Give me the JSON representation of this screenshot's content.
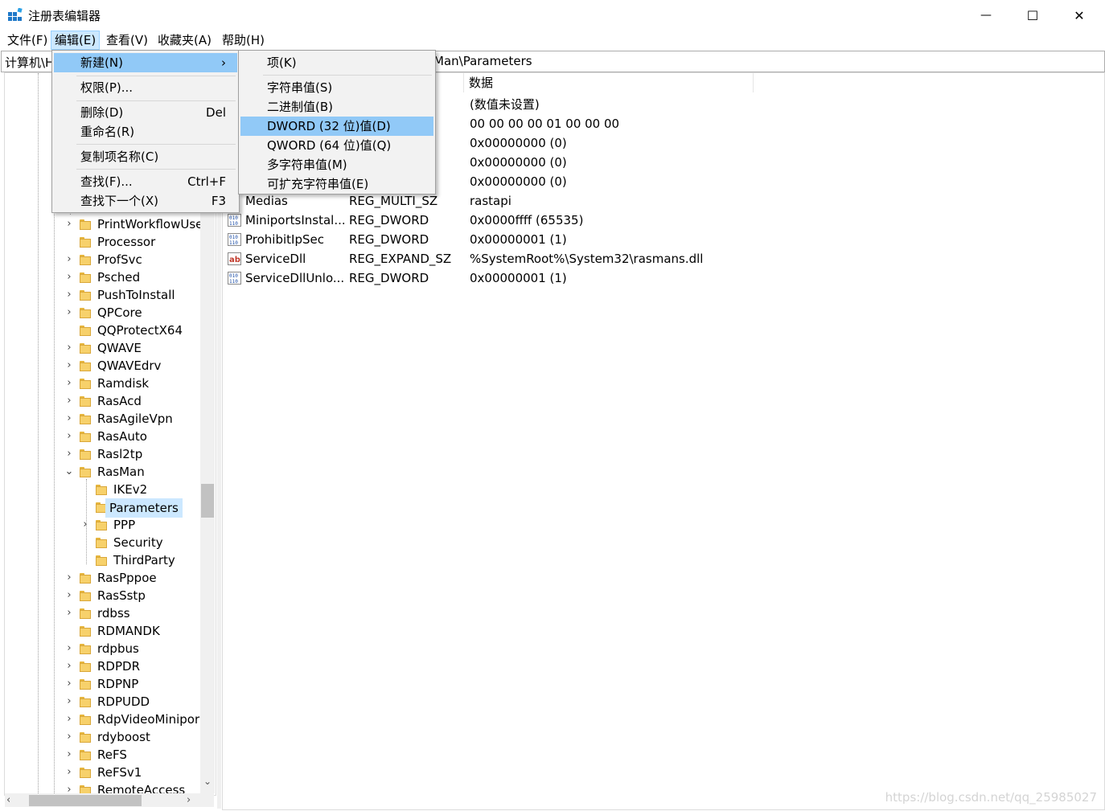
{
  "window": {
    "title": "注册表编辑器",
    "minimize_glyph": "—",
    "maximize_glyph": "☐",
    "close_glyph": "✕"
  },
  "menubar": {
    "items": [
      {
        "label": "文件(F)"
      },
      {
        "label": "编辑(E)",
        "active": true
      },
      {
        "label": "查看(V)"
      },
      {
        "label": "收藏夹(A)"
      },
      {
        "label": "帮助(H)"
      }
    ]
  },
  "address": {
    "prefix_visible": "计算机\\H",
    "suffix_visible": "Man\\Parameters"
  },
  "tree": {
    "items": [
      {
        "label": "PrintWorkflowUse",
        "expander": "collapsed"
      },
      {
        "label": "Processor",
        "expander": "none"
      },
      {
        "label": "ProfSvc",
        "expander": "collapsed"
      },
      {
        "label": "Psched",
        "expander": "collapsed"
      },
      {
        "label": "PushToInstall",
        "expander": "collapsed"
      },
      {
        "label": "QPCore",
        "expander": "collapsed"
      },
      {
        "label": "QQProtectX64",
        "expander": "none"
      },
      {
        "label": "QWAVE",
        "expander": "collapsed"
      },
      {
        "label": "QWAVEdrv",
        "expander": "collapsed"
      },
      {
        "label": "Ramdisk",
        "expander": "collapsed"
      },
      {
        "label": "RasAcd",
        "expander": "collapsed"
      },
      {
        "label": "RasAgileVpn",
        "expander": "collapsed"
      },
      {
        "label": "RasAuto",
        "expander": "collapsed"
      },
      {
        "label": "Rasl2tp",
        "expander": "collapsed"
      },
      {
        "label": "RasMan",
        "expander": "expanded"
      },
      {
        "label": "IKEv2",
        "expander": "none",
        "child": true
      },
      {
        "label": "Parameters",
        "expander": "none",
        "child": true,
        "selected": true
      },
      {
        "label": "PPP",
        "expander": "collapsed",
        "child": true
      },
      {
        "label": "Security",
        "expander": "none",
        "child": true
      },
      {
        "label": "ThirdParty",
        "expander": "none",
        "child": true
      },
      {
        "label": "RasPppoe",
        "expander": "collapsed"
      },
      {
        "label": "RasSstp",
        "expander": "collapsed"
      },
      {
        "label": "rdbss",
        "expander": "collapsed"
      },
      {
        "label": "RDMANDK",
        "expander": "none"
      },
      {
        "label": "rdpbus",
        "expander": "collapsed"
      },
      {
        "label": "RDPDR",
        "expander": "collapsed"
      },
      {
        "label": "RDPNP",
        "expander": "collapsed"
      },
      {
        "label": "RDPUDD",
        "expander": "collapsed"
      },
      {
        "label": "RdpVideoMinipor",
        "expander": "collapsed"
      },
      {
        "label": "rdyboost",
        "expander": "collapsed"
      },
      {
        "label": "ReFS",
        "expander": "collapsed"
      },
      {
        "label": "ReFSv1",
        "expander": "collapsed"
      },
      {
        "label": "RemoteAccess",
        "expander": "collapsed"
      }
    ]
  },
  "list": {
    "header_data": "数据",
    "rows": [
      {
        "name": "",
        "type": "",
        "data": "(数值未设置)",
        "icon": "none"
      },
      {
        "name": "",
        "type": "",
        "data": "00 00 00 00 01 00 00 00",
        "icon": "none"
      },
      {
        "name": "",
        "type": "",
        "data": "0x00000000 (0)",
        "icon": "none"
      },
      {
        "name": "",
        "type": "",
        "data": "0x00000000 (0)",
        "icon": "none"
      },
      {
        "name": "",
        "type": "",
        "data": "0x00000000 (0)",
        "icon": "none"
      },
      {
        "name": "Medias",
        "type": "REG_MULTI_SZ",
        "data": "rastapi",
        "icon": "none"
      },
      {
        "name": "MiniportsInstal...",
        "type": "REG_DWORD",
        "data": "0x0000ffff (65535)",
        "icon": "binary-value-icon"
      },
      {
        "name": "ProhibitIpSec",
        "type": "REG_DWORD",
        "data": "0x00000001 (1)",
        "icon": "binary-value-icon"
      },
      {
        "name": "ServiceDll",
        "type": "REG_EXPAND_SZ",
        "data": "%SystemRoot%\\System32\\rasmans.dll",
        "icon": "string-value-icon"
      },
      {
        "name": "ServiceDllUnlo...",
        "type": "REG_DWORD",
        "data": "0x00000001 (1)",
        "icon": "binary-value-icon"
      }
    ]
  },
  "edit_menu": {
    "items": [
      {
        "label": "新建(N)",
        "shortcut": "",
        "submenu_arrow": "›",
        "highlighted": true
      },
      {
        "label": "权限(P)...",
        "shortcut": ""
      },
      {
        "label": "删除(D)",
        "shortcut": "Del"
      },
      {
        "label": "重命名(R)",
        "shortcut": ""
      },
      {
        "label": "复制项名称(C)",
        "shortcut": ""
      },
      {
        "label": "查找(F)...",
        "shortcut": "Ctrl+F"
      },
      {
        "label": "查找下一个(X)",
        "shortcut": "F3"
      }
    ]
  },
  "new_submenu": {
    "items": [
      {
        "label": "项(K)"
      },
      {
        "label": "字符串值(S)"
      },
      {
        "label": "二进制值(B)"
      },
      {
        "label": "DWORD (32 位)值(D)",
        "highlighted": true
      },
      {
        "label": "QWORD (64 位)值(Q)"
      },
      {
        "label": "多字符串值(M)"
      },
      {
        "label": "可扩充字符串值(E)"
      }
    ]
  },
  "watermark": "https://blog.csdn.net/qq_25985027",
  "colors": {
    "menu_highlight": "#91c9f7",
    "selection": "#cce8ff",
    "folder": "#f7d16b"
  }
}
